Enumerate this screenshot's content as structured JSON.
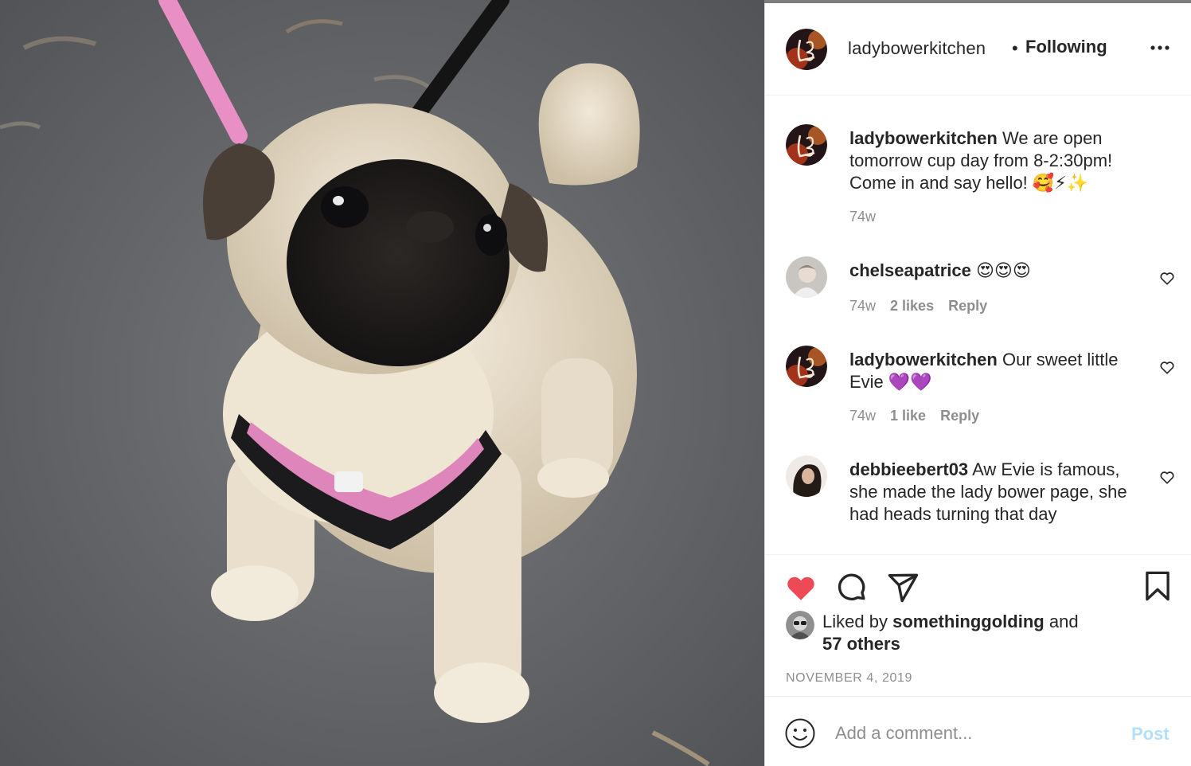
{
  "post": {
    "username": "ladybowerkitchen",
    "separator": "•",
    "follow_status": "Following",
    "more_icon": "ellipsis-icon"
  },
  "comments": [
    {
      "username": "ladybowerkitchen",
      "text": "We are open tomorrow cup day from 8-2:30pm! Come in and say hello! 🥰⚡✨",
      "time": "74w",
      "likes": "",
      "reply": ""
    },
    {
      "username": "chelseapatrice",
      "text": "😍😍😍",
      "time": "74w",
      "likes": "2 likes",
      "reply": "Reply"
    },
    {
      "username": "ladybowerkitchen",
      "text": "Our sweet little Evie 💜💜",
      "time": "74w",
      "likes": "1 like",
      "reply": "Reply"
    },
    {
      "username": "debbieebert03",
      "text": "Aw Evie is famous, she made the lady bower page, she had heads turning that day",
      "time": "",
      "likes": "",
      "reply": ""
    }
  ],
  "actions": {
    "liked_prefix": "Liked by",
    "liked_user": "somethinggolding",
    "liked_and": "and",
    "liked_others": "57 others",
    "date": "NOVEMBER 4, 2019",
    "like_color": "#ed4956"
  },
  "composer": {
    "placeholder": "Add a comment...",
    "post_label": "Post"
  }
}
